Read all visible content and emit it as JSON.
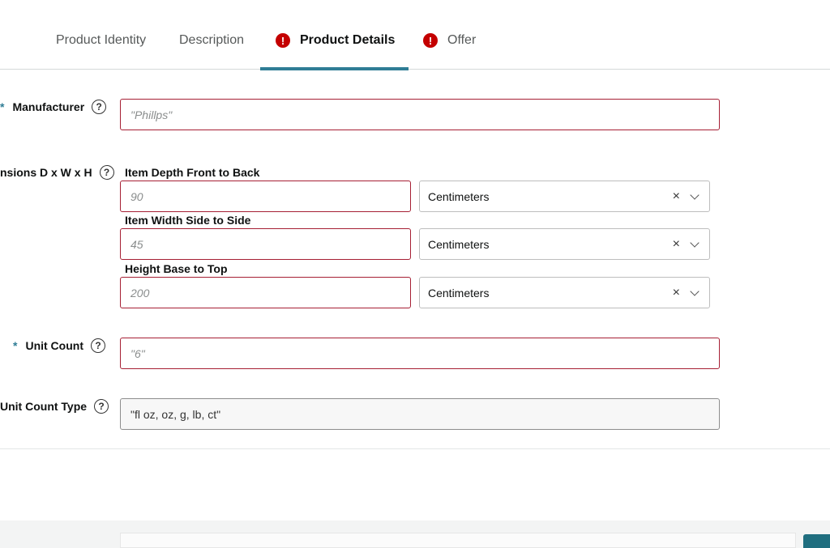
{
  "tabs": [
    {
      "label": "Product Identity",
      "error": false,
      "active": false
    },
    {
      "label": "Description",
      "error": false,
      "active": false
    },
    {
      "label": "Product Details",
      "error": true,
      "active": true
    },
    {
      "label": "Offer",
      "error": true,
      "active": false
    }
  ],
  "error_glyph": "!",
  "help_glyph": "?",
  "required_mark": "*",
  "manufacturer": {
    "label": "Manufacturer",
    "placeholder": "\"Phillps\""
  },
  "dimensions": {
    "label": "nsions D x W x H",
    "depth": {
      "label": "Item Depth Front to Back",
      "placeholder": "90",
      "unit": "Centimeters"
    },
    "width": {
      "label": "Item Width Side to Side",
      "placeholder": "45",
      "unit": "Centimeters"
    },
    "height": {
      "label": "Height Base to Top",
      "placeholder": "200",
      "unit": "Centimeters"
    }
  },
  "unit_count": {
    "label": "Unit Count",
    "placeholder": "\"6\""
  },
  "unit_count_type": {
    "label": "Unit Count Type",
    "value": "\"fl oz, oz, g, lb, ct\""
  },
  "clear_glyph": "×",
  "colors": {
    "accent": "#2f7d95",
    "error": "#c40000",
    "error_border": "#a61f34"
  }
}
